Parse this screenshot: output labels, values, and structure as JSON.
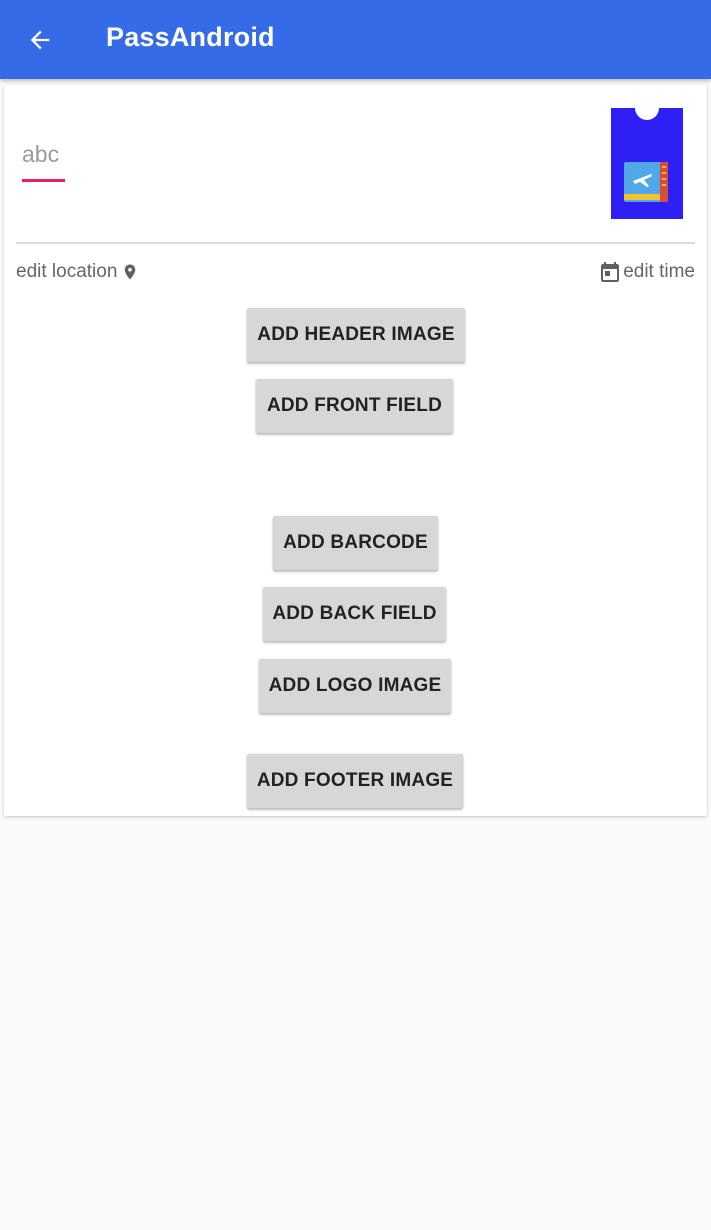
{
  "app_bar": {
    "title": "PassAndroid",
    "background": "#366BE8",
    "back_icon": "arrow-back-icon"
  },
  "pass": {
    "description_value": "abc",
    "accent_color": "#E91E63",
    "thumbnail_icon": "boarding-pass-icon",
    "thumbnail_color": "#2D1FF5",
    "edit_location_label": "edit location",
    "location_icon": "map-pin-icon",
    "edit_time_label": "edit time",
    "time_icon": "calendar-icon"
  },
  "actions": {
    "add_header_image": "ADD HEADER IMAGE",
    "add_front_field": "ADD FRONT FIELD",
    "add_barcode": "ADD BARCODE",
    "add_back_field": "ADD BACK FIELD",
    "add_logo_image": "ADD LOGO IMAGE",
    "add_footer_image": "ADD FOOTER IMAGE"
  }
}
